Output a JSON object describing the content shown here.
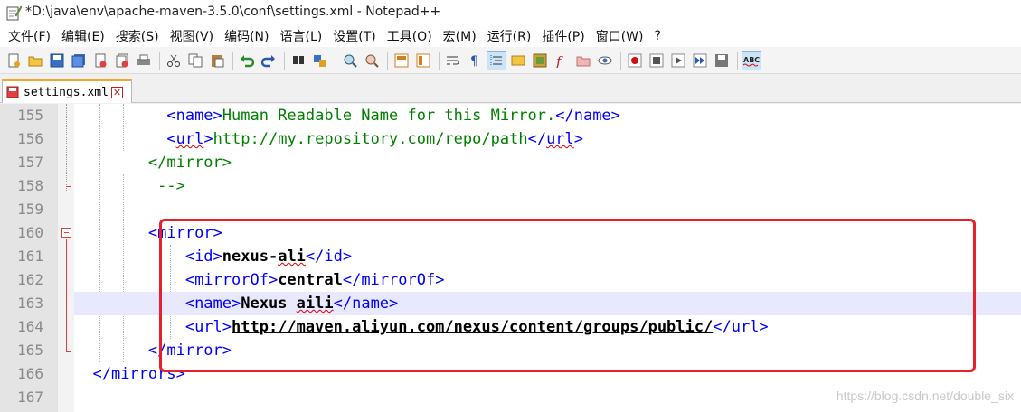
{
  "window": {
    "title": "*D:\\java\\env\\apache-maven-3.5.0\\conf\\settings.xml - Notepad++"
  },
  "menu": {
    "items": [
      "文件(F)",
      "编辑(E)",
      "搜索(S)",
      "视图(V)",
      "编码(N)",
      "语言(L)",
      "设置(T)",
      "工具(O)",
      "宏(M)",
      "运行(R)",
      "插件(P)",
      "窗口(W)",
      "?"
    ]
  },
  "toolbar": {
    "icons": [
      "new-file-icon",
      "open-file-icon",
      "save-icon",
      "save-all-icon",
      "close-icon",
      "close-all-icon",
      "print-icon",
      "cut-icon",
      "copy-icon",
      "paste-icon",
      "undo-icon",
      "redo-icon",
      "find-icon",
      "replace-icon",
      "zoom-in-icon",
      "zoom-out-icon",
      "sync-vertical-icon",
      "sync-horizontal-icon",
      "word-wrap-icon",
      "show-all-chars-icon",
      "indent-guide-icon",
      "doc-map-icon",
      "function-list-icon",
      "folder-workspace-icon",
      "monitoring-icon",
      "record-macro-icon",
      "stop-macro-icon",
      "play-macro-icon",
      "run-macro-multiple-icon",
      "save-macro-icon",
      "spell-check-icon"
    ],
    "spell_check_label": "ABC"
  },
  "tab": {
    "label": "settings.xml"
  },
  "editor": {
    "line_numbers": [
      "155",
      "156",
      "157",
      "158",
      "159",
      "160",
      "161",
      "162",
      "163",
      "164",
      "165",
      "166",
      "167"
    ],
    "lines": {
      "l155_open": "<name>",
      "l155_text": "Human Readable Name for this Mirror.",
      "l155_close": "</name>",
      "l156_open_a": "<",
      "l156_open_b": "url",
      "l156_open_c": ">",
      "l156_link": "http://my.repository.com/repo/path",
      "l156_close_a": "</",
      "l156_close_b": "url",
      "l156_close_c": ">",
      "l157": "</mirror>",
      "l158": "-->",
      "l160": "<mirror>",
      "l161_open": "<id>",
      "l161_val_a": "nexus-",
      "l161_val_b": "ali",
      "l161_close": "</id>",
      "l162_open": "<mirrorOf>",
      "l162_val": "central",
      "l162_close": "</mirrorOf>",
      "l163_open": "<name>",
      "l163_val_a": "Nexus ",
      "l163_val_b": "aili",
      "l163_close": "</name>",
      "l164_open": "<url>",
      "l164_val": "http://maven.aliyun.com/nexus/content/groups/public/",
      "l164_close": "</url>",
      "l165": "</mirror>",
      "l166": "</mirrors>"
    }
  },
  "watermark": "https://blog.csdn.net/double_six",
  "colors": {
    "tag": "#0000ff",
    "comment": "#008000",
    "highlight_border": "#e8202a",
    "current_line": "#e8e8ff"
  }
}
